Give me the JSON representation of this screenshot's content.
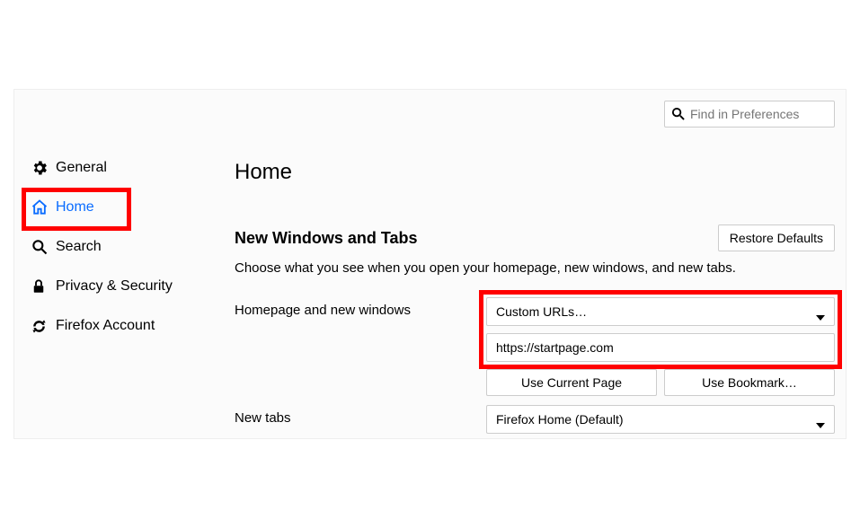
{
  "search": {
    "placeholder": "Find in Preferences"
  },
  "sidebar": {
    "items": [
      {
        "label": "General"
      },
      {
        "label": "Home"
      },
      {
        "label": "Search"
      },
      {
        "label": "Privacy & Security"
      },
      {
        "label": "Firefox Account"
      }
    ]
  },
  "page": {
    "title": "Home"
  },
  "section": {
    "heading": "New Windows and Tabs",
    "restore_btn": "Restore Defaults",
    "desc": "Choose what you see when you open your homepage, new windows, and new tabs."
  },
  "homepage": {
    "label": "Homepage and new windows",
    "select_value": "Custom URLs…",
    "url_value": "https://startpage.com",
    "use_current": "Use Current Page",
    "use_bookmark": "Use Bookmark…"
  },
  "newtabs": {
    "label": "New tabs",
    "select_value": "Firefox Home (Default)"
  }
}
